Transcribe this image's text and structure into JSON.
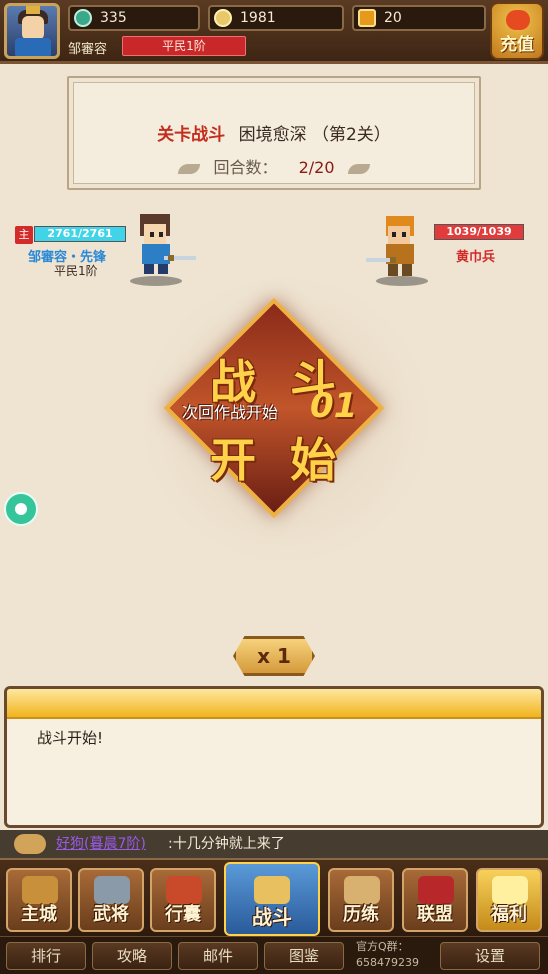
{
  "resources": {
    "jade": "335",
    "coins": "1981",
    "gold": "20"
  },
  "player": {
    "name": "邹審容",
    "rank": "平民1阶"
  },
  "recharge_label": "充值",
  "stage": {
    "title_red": "关卡战斗",
    "title": "困境愈深",
    "level": "（第2关）",
    "round_label": "回合数：",
    "round_value": "2/20"
  },
  "ally": {
    "tag": "主",
    "hp": "2761/2761",
    "hp_fraction": 1.0,
    "name": "邹審容・先锋",
    "rank": "平民1阶"
  },
  "enemy": {
    "hp": "1039/1039",
    "hp_fraction": 1.0,
    "name": "黄巾兵"
  },
  "battle": {
    "chars": [
      "战",
      "斗",
      "开",
      "始"
    ],
    "next_round": "次回作战开始",
    "countdown": "01"
  },
  "speed": "x 1",
  "log": {
    "text": "战斗开始!"
  },
  "chat": {
    "user": "好狗(暮晨7阶)",
    "message": ":十几分钟就上来了"
  },
  "nav": {
    "items": [
      "主城",
      "武将",
      "行囊",
      "战斗",
      "历练",
      "联盟",
      "福利"
    ]
  },
  "bottom": {
    "rank": "排行",
    "guide": "攻略",
    "mail": "邮件",
    "atlas": "图鉴",
    "qq_label": "官方Q群：",
    "qq_number": "658479239",
    "settings": "设置"
  },
  "colors": {
    "hp_ally": "#41d4e8",
    "hp_enemy": "#e23b3b",
    "accent_red": "#c22d1e",
    "gold": "#ffd24a"
  }
}
